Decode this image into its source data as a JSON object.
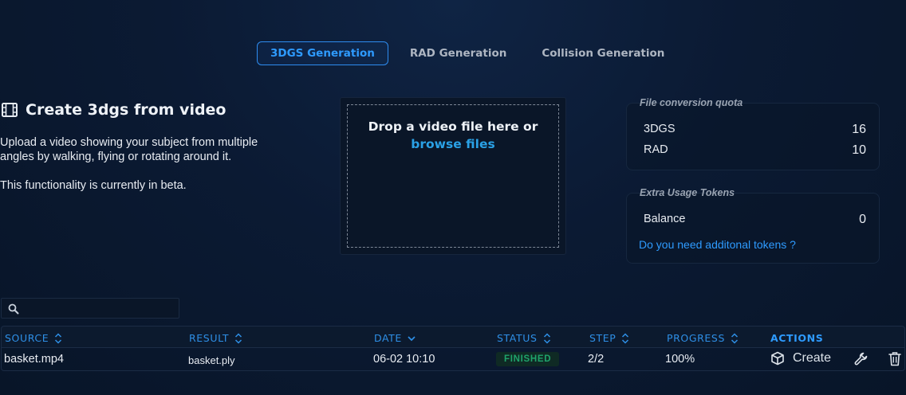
{
  "tabs": [
    {
      "label": "3DGS Generation",
      "active": true
    },
    {
      "label": "RAD Generation",
      "active": false
    },
    {
      "label": "Collision Generation",
      "active": false
    }
  ],
  "intro": {
    "icon": "film-icon",
    "title": "Create 3dgs from video",
    "description": "Upload a video showing your subject from multiple angles by walking, flying or rotating around it.",
    "beta_note": "This functionality is currently in beta."
  },
  "dropzone": {
    "prompt": "Drop a video file here or",
    "link": "browse files"
  },
  "quota": {
    "legend": "File conversion quota",
    "items": [
      {
        "label": "3DGS",
        "value": "16"
      },
      {
        "label": "RAD",
        "value": "10"
      }
    ]
  },
  "tokens": {
    "legend": "Extra Usage Tokens",
    "balance_label": "Balance",
    "balance_value": "0",
    "link": "Do you need additonal tokens ?"
  },
  "search": {
    "placeholder": "",
    "value": ""
  },
  "table": {
    "columns": [
      "SOURCE",
      "RESULT",
      "DATE",
      "STATUS",
      "STEP",
      "PROGRESS",
      "ACTIONS"
    ],
    "rows": [
      {
        "source": "basket.mp4",
        "result": "basket.ply",
        "date": "06-02 10:10",
        "status": "FINISHED",
        "step": "2/2",
        "progress": "100%",
        "action_label": "Create"
      }
    ]
  },
  "colors": {
    "accent": "#2e9bff",
    "link": "#2aa1e6",
    "status_finished": "#1fa46b",
    "background": "#0b1a33"
  }
}
